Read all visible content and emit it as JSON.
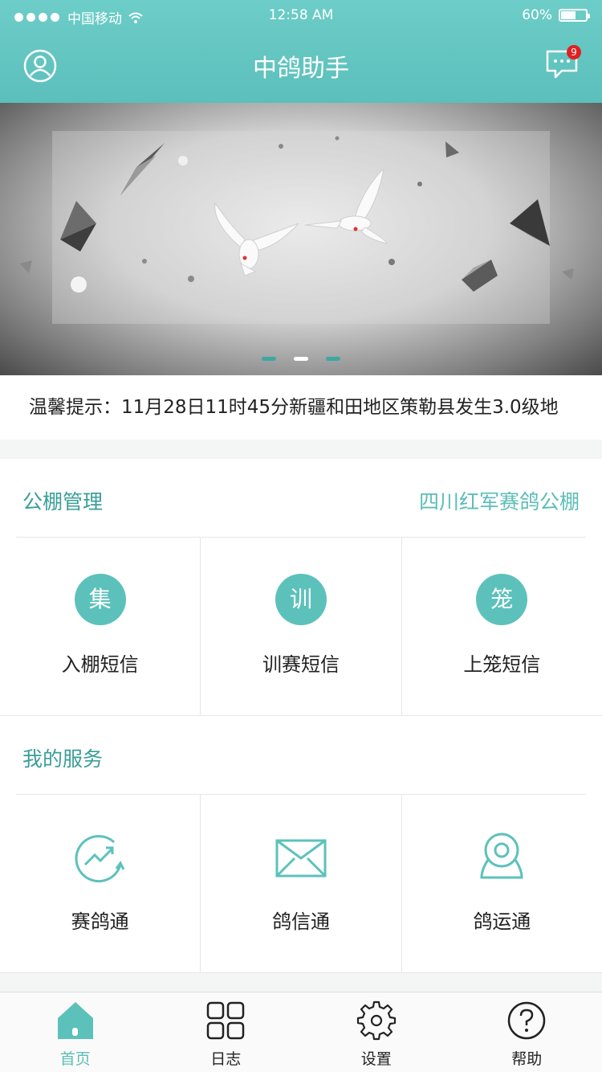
{
  "status_bar": {
    "carrier": "中国移动",
    "time": "12:58 AM",
    "battery": "60%",
    "battery_level": 0.6
  },
  "header": {
    "title": "中鸽助手",
    "message_badge": "9"
  },
  "banner": {
    "page_count": 3,
    "active_index": 1
  },
  "notice": {
    "text": "温馨提示：11月28日11时45分新疆和田地区策勒县发生3.0级地"
  },
  "loft_section": {
    "title": "公棚管理",
    "loft_name": "四川红军赛鸽公棚",
    "items": [
      {
        "icon_char": "集",
        "label": "入棚短信"
      },
      {
        "icon_char": "训",
        "label": "训赛短信"
      },
      {
        "icon_char": "笼",
        "label": "上笼短信"
      }
    ]
  },
  "service_section": {
    "title": "我的服务",
    "items": [
      {
        "icon": "trend-chart-icon",
        "label": "赛鸽通"
      },
      {
        "icon": "envelope-icon",
        "label": "鸽信通"
      },
      {
        "icon": "camera-icon",
        "label": "鸽运通"
      }
    ]
  },
  "tabbar": {
    "items": [
      {
        "icon": "home-icon",
        "label": "首页"
      },
      {
        "icon": "grid-icon",
        "label": "日志"
      },
      {
        "icon": "gear-icon",
        "label": "设置"
      },
      {
        "icon": "help-icon",
        "label": "帮助"
      }
    ]
  },
  "colors": {
    "accent": "#5cc1bb",
    "accent_dark": "#3a9e98",
    "badge": "#e02020"
  }
}
